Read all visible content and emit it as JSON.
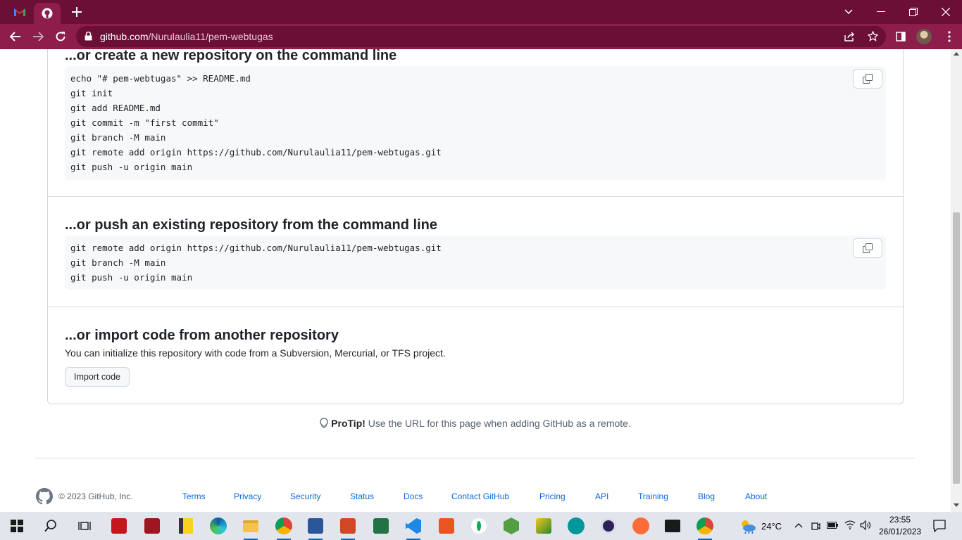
{
  "browser": {
    "tabs": [
      {
        "name": "gmail-tab",
        "icon": "gmail-icon"
      },
      {
        "name": "github-tab",
        "icon": "github-icon"
      }
    ],
    "url_host": "github.com",
    "url_path": "/Nurulaulia11/pem-webtugas"
  },
  "sections": {
    "new_repo": {
      "title": "...or create a new repository on the command line",
      "lines": [
        "echo \"# pem-webtugas\" >> README.md",
        "git init",
        "git add README.md",
        "git commit -m \"first commit\"",
        "git branch -M main",
        "git remote add origin https://github.com/Nurulaulia11/pem-webtugas.git",
        "git push -u origin main"
      ]
    },
    "push_existing": {
      "title": "...or push an existing repository from the command line",
      "lines": [
        "git remote add origin https://github.com/Nurulaulia11/pem-webtugas.git",
        "git branch -M main",
        "git push -u origin main"
      ]
    },
    "import": {
      "title": "...or import code from another repository",
      "description": "You can initialize this repository with code from a Subversion, Mercurial, or TFS project.",
      "button": "Import code"
    }
  },
  "protip": {
    "label": "ProTip!",
    "text": " Use the URL for this page when adding GitHub as a remote."
  },
  "footer": {
    "copyright": "© 2023 GitHub, Inc.",
    "links": [
      "Terms",
      "Privacy",
      "Security",
      "Status",
      "Docs",
      "Contact GitHub",
      "Pricing",
      "API",
      "Training",
      "Blog",
      "About"
    ]
  },
  "taskbar": {
    "weather": "24°C",
    "time": "23:55",
    "date": "26/01/2023"
  },
  "colors": {
    "browser_frame": "#6b0f36",
    "toolbar": "#8d1d4b",
    "link": "#0969da"
  }
}
